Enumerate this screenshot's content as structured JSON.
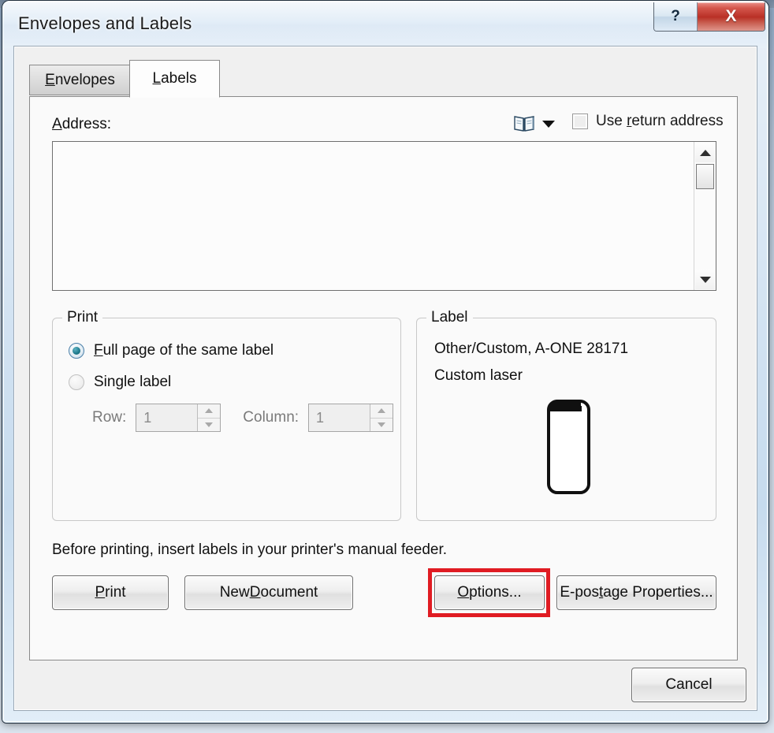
{
  "window": {
    "title": "Envelopes and Labels",
    "help_button": "?",
    "close_button": "X"
  },
  "tabs": [
    {
      "label_before": "E",
      "accel": "",
      "label": "Envelopes",
      "accel_char": "E",
      "active": false
    },
    {
      "label": "Labels",
      "accel_char": "L",
      "active": true
    }
  ],
  "tab_labels": {
    "envelopes": "Envelopes",
    "labels": "Labels"
  },
  "address": {
    "label": "Address:",
    "label_accel": "A",
    "label_rest": "ddress:",
    "value": "",
    "placeholder": "",
    "addressbook_icon": "address-book-icon",
    "dropdown_icon": "chevron-down-icon"
  },
  "return_address": {
    "label_pre": "Use ",
    "label_accel": "r",
    "label_post": "eturn address",
    "full_label": "Use return address",
    "checked": false,
    "enabled": false
  },
  "print_group": {
    "title": "Print",
    "options": [
      {
        "label": "Full page of the same label",
        "accel": "F",
        "pre": "",
        "post": "ull page of the same label",
        "selected": true,
        "enabled": true
      },
      {
        "label": "Single label",
        "accel": "g",
        "pre": "Sin",
        "post": "le label",
        "selected": false,
        "enabled": true
      }
    ],
    "row": {
      "label": "Row:",
      "value": "1",
      "enabled": false
    },
    "column": {
      "label": "Column:",
      "value": "1",
      "enabled": false
    }
  },
  "label_group": {
    "title": "Label",
    "line1": "Other/Custom, A-ONE 28171",
    "line2": "Custom laser",
    "preview_icon": "label-preview-shape"
  },
  "footer": {
    "note": "Before printing, insert labels in your printer's manual feeder.",
    "buttons": [
      {
        "label": "Print",
        "accel": "P",
        "pre": "",
        "post": "rint"
      },
      {
        "label": "New Document",
        "accel": "D",
        "pre": "New ",
        "post": "ocument"
      },
      {
        "label": "Options...",
        "accel": "O",
        "pre": "",
        "post": "ptions...",
        "highlighted": true
      },
      {
        "label": "E-postage Properties...",
        "accel": "t",
        "pre": "E-pos",
        "post": "age Properties..."
      }
    ],
    "cancel_label": "Cancel"
  },
  "highlight": {
    "color": "#e01c23",
    "target": "Options..."
  },
  "colors": {
    "dialog_background": "#f0f0f0",
    "tab_page_background": "#fafafa",
    "close_button": "#b93026",
    "radio_selected": "#1d7a8c",
    "annotation": "#e01c23"
  }
}
